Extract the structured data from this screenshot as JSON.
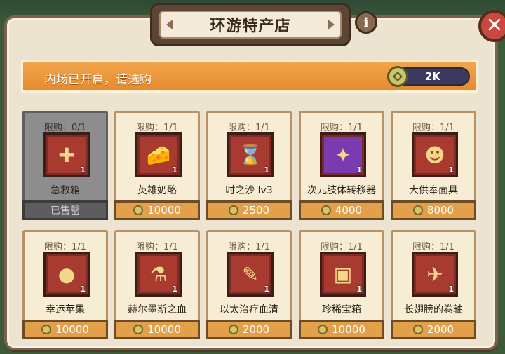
{
  "title": "环游特产店",
  "info_label": "i",
  "banner": {
    "message": "内场已开启，请选购",
    "currency_amount": "2K"
  },
  "items": [
    {
      "limit": "限购：0/1",
      "name": "急救箱",
      "qty": "1",
      "sold": true,
      "sold_label": "已售罄",
      "icon": "first-aid-kit-icon",
      "glyph": "✚",
      "color": "#a83a30"
    },
    {
      "limit": "限购：1/1",
      "name": "英雄奶酪",
      "qty": "1",
      "price": "10000",
      "icon": "cheese-icon",
      "glyph": "🧀",
      "color": "#a83a30"
    },
    {
      "limit": "限购：1/1",
      "name": "时之沙 lv3",
      "qty": "1",
      "price": "2500",
      "icon": "hourglass-icon",
      "glyph": "⌛",
      "color": "#a83a30"
    },
    {
      "limit": "限购：1/1",
      "name": "次元肢体转移器",
      "qty": "1",
      "price": "4000",
      "icon": "crystal-device-icon",
      "glyph": "✦",
      "color": "#7b3bb0"
    },
    {
      "limit": "限购：1/1",
      "name": "大供奉面具",
      "qty": "1",
      "price": "8000",
      "icon": "golden-mask-icon",
      "glyph": "☻",
      "color": "#a83a30"
    },
    {
      "limit": "限购：1/1",
      "name": "幸运苹果",
      "qty": "1",
      "price": "10000",
      "icon": "apple-icon",
      "glyph": "●",
      "color": "#a83a30"
    },
    {
      "limit": "限购：1/1",
      "name": "赫尔墨斯之血",
      "qty": "1",
      "price": "10000",
      "icon": "potion-icon",
      "glyph": "⚗",
      "color": "#a83a30"
    },
    {
      "limit": "限购：1/1",
      "name": "以太治疗血清",
      "qty": "1",
      "price": "2000",
      "icon": "syringe-icon",
      "glyph": "✎",
      "color": "#a83a30"
    },
    {
      "limit": "限购：1/1",
      "name": "珍稀宝箱",
      "qty": "1",
      "price": "10000",
      "icon": "treasure-chest-icon",
      "glyph": "▣",
      "color": "#a83a30"
    },
    {
      "limit": "限购：1/1",
      "name": "长翅膀的卷轴",
      "qty": "1",
      "price": "2000",
      "icon": "winged-scroll-icon",
      "glyph": "✈",
      "color": "#a83a30"
    }
  ]
}
